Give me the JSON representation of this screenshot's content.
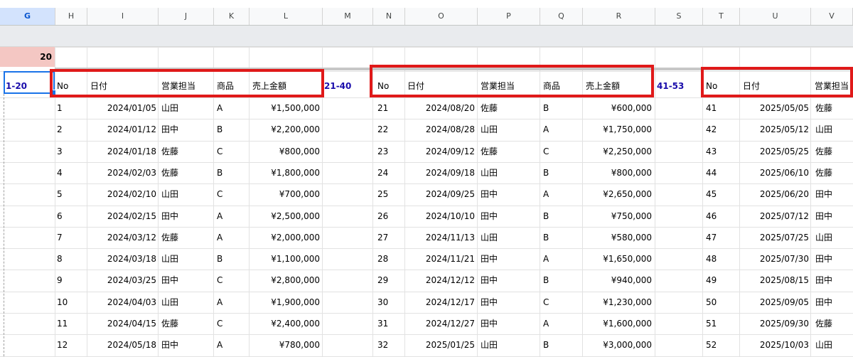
{
  "sheet": {
    "columns": [
      "G",
      "H",
      "I",
      "J",
      "K",
      "L",
      "M",
      "N",
      "O",
      "P",
      "Q",
      "R",
      "S",
      "T",
      "U",
      "V"
    ],
    "selected_column": "G",
    "pink_cell_value": "20",
    "range_labels": [
      "1-20",
      "21-40",
      "41-53"
    ],
    "colors": {
      "highlight_red": "#e01919",
      "selection_blue": "#1a73e8",
      "pink_fill": "#f4c7c3",
      "label_blue": "#1a0dab"
    }
  },
  "tables": [
    {
      "headers": [
        "No",
        "日付",
        "営業担当",
        "商品",
        "売上金額"
      ],
      "rows": [
        [
          "1",
          "2024/01/05",
          "山田",
          "A",
          "¥1,500,000"
        ],
        [
          "2",
          "2024/01/12",
          "田中",
          "B",
          "¥2,200,000"
        ],
        [
          "3",
          "2024/01/18",
          "佐藤",
          "C",
          "¥800,000"
        ],
        [
          "4",
          "2024/02/03",
          "佐藤",
          "B",
          "¥1,800,000"
        ],
        [
          "5",
          "2024/02/10",
          "山田",
          "C",
          "¥700,000"
        ],
        [
          "6",
          "2024/02/15",
          "田中",
          "A",
          "¥2,500,000"
        ],
        [
          "7",
          "2024/03/12",
          "佐藤",
          "A",
          "¥2,000,000"
        ],
        [
          "8",
          "2024/03/18",
          "山田",
          "B",
          "¥1,100,000"
        ],
        [
          "9",
          "2024/03/25",
          "田中",
          "C",
          "¥2,800,000"
        ],
        [
          "10",
          "2024/04/03",
          "山田",
          "A",
          "¥1,900,000"
        ],
        [
          "11",
          "2024/04/15",
          "佐藤",
          "C",
          "¥2,400,000"
        ],
        [
          "12",
          "2024/05/18",
          "田中",
          "A",
          "¥780,000"
        ]
      ]
    },
    {
      "headers": [
        "No",
        "日付",
        "営業担当",
        "商品",
        "売上金額"
      ],
      "rows": [
        [
          "21",
          "2024/08/20",
          "佐藤",
          "B",
          "¥600,000"
        ],
        [
          "22",
          "2024/08/28",
          "山田",
          "A",
          "¥1,750,000"
        ],
        [
          "23",
          "2024/09/12",
          "佐藤",
          "C",
          "¥2,250,000"
        ],
        [
          "24",
          "2024/09/18",
          "山田",
          "B",
          "¥800,000"
        ],
        [
          "25",
          "2024/09/25",
          "田中",
          "A",
          "¥2,650,000"
        ],
        [
          "26",
          "2024/10/10",
          "田中",
          "B",
          "¥750,000"
        ],
        [
          "27",
          "2024/11/13",
          "山田",
          "B",
          "¥580,000"
        ],
        [
          "28",
          "2024/11/21",
          "田中",
          "A",
          "¥1,650,000"
        ],
        [
          "29",
          "2024/12/12",
          "田中",
          "B",
          "¥940,000"
        ],
        [
          "30",
          "2024/12/17",
          "田中",
          "C",
          "¥1,230,000"
        ],
        [
          "31",
          "2024/12/27",
          "田中",
          "A",
          "¥1,600,000"
        ],
        [
          "32",
          "2025/01/25",
          "山田",
          "B",
          "¥3,000,000"
        ]
      ]
    },
    {
      "headers": [
        "No",
        "日付",
        "営業担当"
      ],
      "rows": [
        [
          "41",
          "2025/05/05",
          "佐藤"
        ],
        [
          "42",
          "2025/05/12",
          "山田"
        ],
        [
          "43",
          "2025/05/25",
          "佐藤"
        ],
        [
          "44",
          "2025/06/10",
          "佐藤"
        ],
        [
          "45",
          "2025/06/20",
          "田中"
        ],
        [
          "46",
          "2025/07/12",
          "田中"
        ],
        [
          "47",
          "2025/07/25",
          "山田"
        ],
        [
          "48",
          "2025/07/30",
          "田中"
        ],
        [
          "49",
          "2025/08/15",
          "田中"
        ],
        [
          "50",
          "2025/09/05",
          "田中"
        ],
        [
          "51",
          "2025/09/30",
          "佐藤"
        ],
        [
          "52",
          "2025/10/03",
          "山田"
        ]
      ]
    }
  ]
}
